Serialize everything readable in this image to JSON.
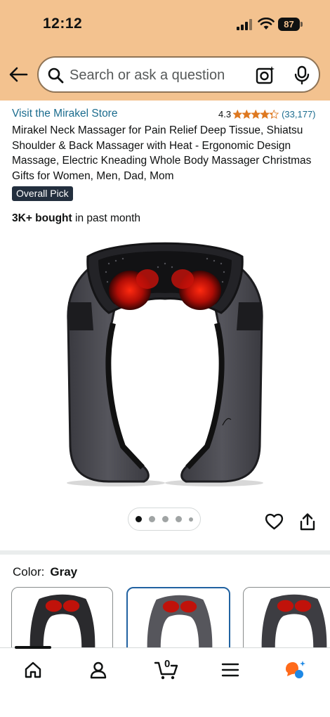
{
  "status_bar": {
    "time": "12:12",
    "battery": "87"
  },
  "search": {
    "placeholder": "Search or ask a question"
  },
  "product": {
    "store_link": "Visit the Mirakel Store",
    "rating": "4.3",
    "stars": 4.3,
    "rating_count": "(33,177)",
    "title": "Mirakel Neck Massager for Pain Relief Deep Tissue, Shiatsu Shoulder & Back Massager with Heat - Ergonomic Design Massage, Electric Kneading Whole Body Massager Christmas Gifts for Women, Men, Dad, Mom",
    "badge": "Overall Pick",
    "bought_bold": "3K+ bought",
    "bought_rest": " in past month",
    "image_pager": {
      "total": 5,
      "active_index": 0
    }
  },
  "color": {
    "label": "Color:",
    "value": "Gray"
  },
  "bottom_nav": {
    "items": [
      "home-icon",
      "account-icon",
      "cart-icon",
      "menu-icon",
      "rufus-icon"
    ],
    "cart_count": "0",
    "active": "home"
  },
  "colors": {
    "header_bg": "#f3c28f",
    "link": "#1b6c8e",
    "star": "#de7921",
    "badge_bg": "#232f3e",
    "selected_swatch": "#2162a1"
  }
}
